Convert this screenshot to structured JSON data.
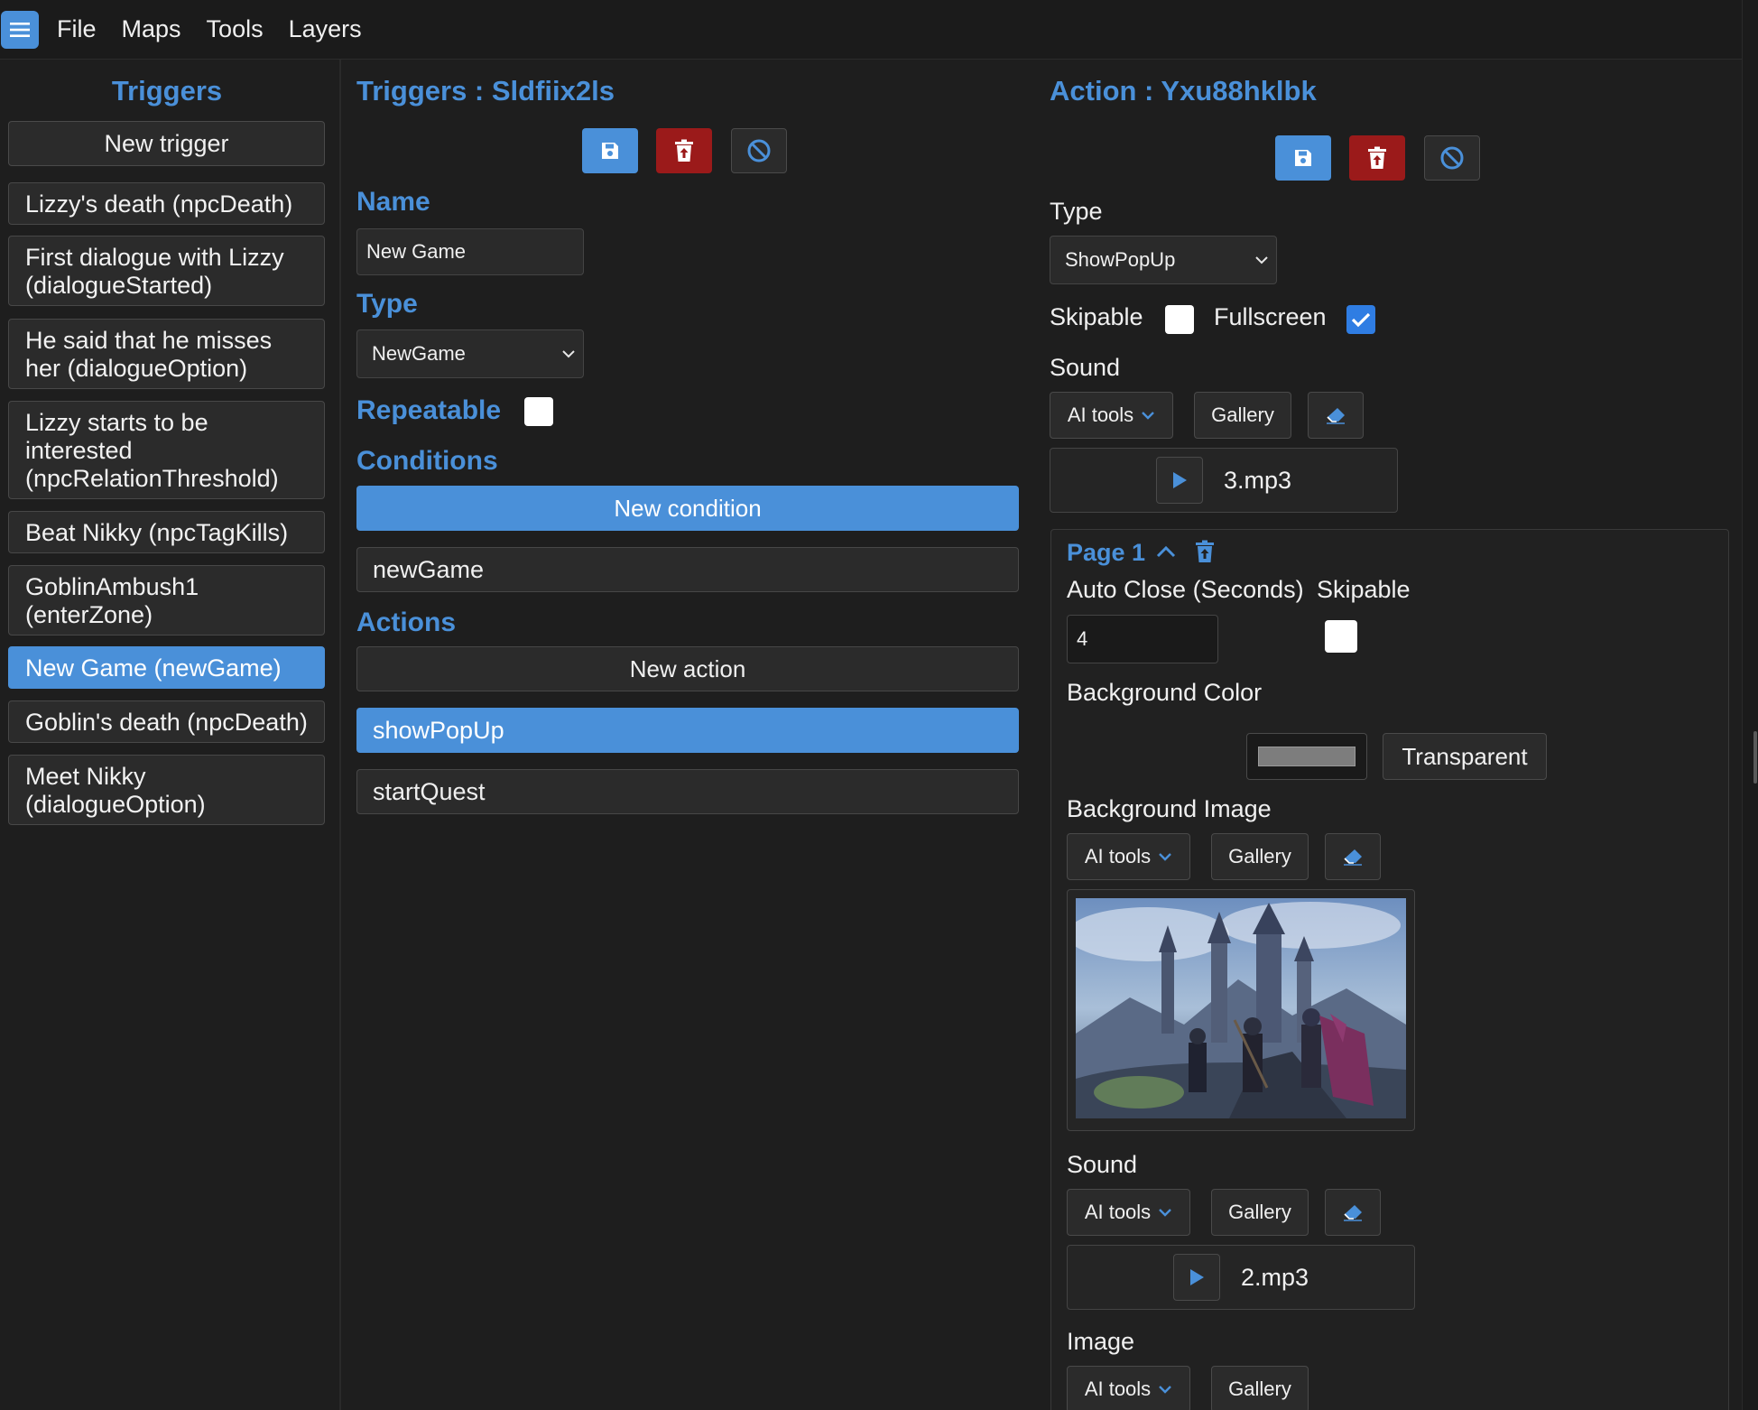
{
  "menubar": {
    "items": [
      "File",
      "Maps",
      "Tools",
      "Layers"
    ]
  },
  "left": {
    "title": "Triggers",
    "new_trigger_label": "New trigger",
    "triggers": [
      "Lizzy's death (npcDeath)",
      "First dialogue with Lizzy (dialogueStarted)",
      "He said that he misses her (dialogueOption)",
      "Lizzy starts to be interested (npcRelationThreshold)",
      "Beat Nikky (npcTagKills)",
      "GoblinAmbush1 (enterZone)",
      "New Game (newGame)",
      "Goblin's death (npcDeath)",
      "Meet Nikky (dialogueOption)"
    ],
    "active_index": 6
  },
  "middle": {
    "title": "Triggers : Sldfiix2ls",
    "name_label": "Name",
    "name_value": "New Game",
    "type_label": "Type",
    "type_value": "NewGame",
    "repeatable_label": "Repeatable",
    "repeatable_checked": false,
    "conditions_label": "Conditions",
    "new_condition_label": "New condition",
    "conditions": [
      "newGame"
    ],
    "actions_label": "Actions",
    "new_action_label": "New action",
    "actions": [
      "showPopUp",
      "startQuest"
    ],
    "active_action_index": 0
  },
  "right": {
    "title": "Action : Yxu88hklbk",
    "type_label": "Type",
    "type_value": "ShowPopUp",
    "skipable_label": "Skipable",
    "skipable_checked": false,
    "fullscreen_label": "Fullscreen",
    "fullscreen_checked": true,
    "sound_label": "Sound",
    "ai_tools_label": "AI tools",
    "gallery_label": "Gallery",
    "sound_file": "3.mp3",
    "page": {
      "title": "Page 1",
      "auto_close_label": "Auto Close (Seconds)",
      "auto_close_value": "4",
      "skipable_label": "Skipable",
      "skipable_checked": false,
      "bg_color_label": "Background Color",
      "bg_color_value": "#7d7d7d",
      "transparent_label": "Transparent",
      "bg_image_label": "Background Image",
      "ai_tools_label": "AI tools",
      "gallery_label": "Gallery",
      "sound_label": "Sound",
      "sound_file": "2.mp3",
      "image_label": "Image"
    }
  },
  "colors": {
    "accent": "#4a90d9",
    "danger": "#9b1a1a",
    "background": "#1e1e1e",
    "panel": "#2b2b2b"
  }
}
